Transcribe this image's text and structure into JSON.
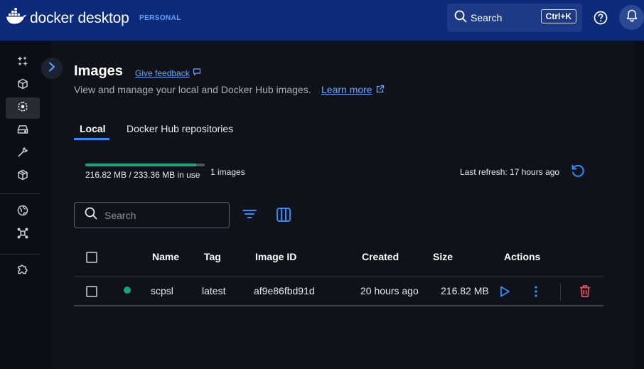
{
  "app": {
    "logo_text": "docker desktop",
    "plan_badge": "PERSONAL",
    "search_label": "Search",
    "search_shortcut": "Ctrl+K"
  },
  "page": {
    "title": "Images",
    "feedback_link": "Give feedback",
    "subtitle": "View and manage your local and Docker Hub images.",
    "learn_more": "Learn more"
  },
  "tabs": [
    {
      "label": "Local",
      "active": true
    },
    {
      "label": "Docker Hub repositories",
      "active": false
    }
  ],
  "usage": {
    "text": "216.82 MB / 233.36 MB in use",
    "fraction": 0.93,
    "image_count": "1 images",
    "last_refresh": "Last refresh: 17 hours ago"
  },
  "search": {
    "placeholder": "Search"
  },
  "table": {
    "columns": [
      "Name",
      "Tag",
      "Image ID",
      "Created",
      "Size",
      "Actions"
    ],
    "rows": [
      {
        "status": "in-use",
        "name": "scpsl",
        "tag": "latest",
        "image_id": "af9e86fbd91d",
        "created": "20 hours ago",
        "size": "216.82 MB"
      }
    ]
  },
  "colors": {
    "topbar": "#0b2a7a",
    "accent": "#2f8cff",
    "in_use": "#15a37a",
    "delete": "#e05561"
  },
  "icons": {
    "rail": [
      "ask-gordon-icon",
      "containers-icon",
      "images-icon",
      "volumes-icon",
      "builds-icon",
      "models-icon",
      "docker-hub-icon",
      "docker-scout-icon",
      "extensions-icon"
    ]
  }
}
